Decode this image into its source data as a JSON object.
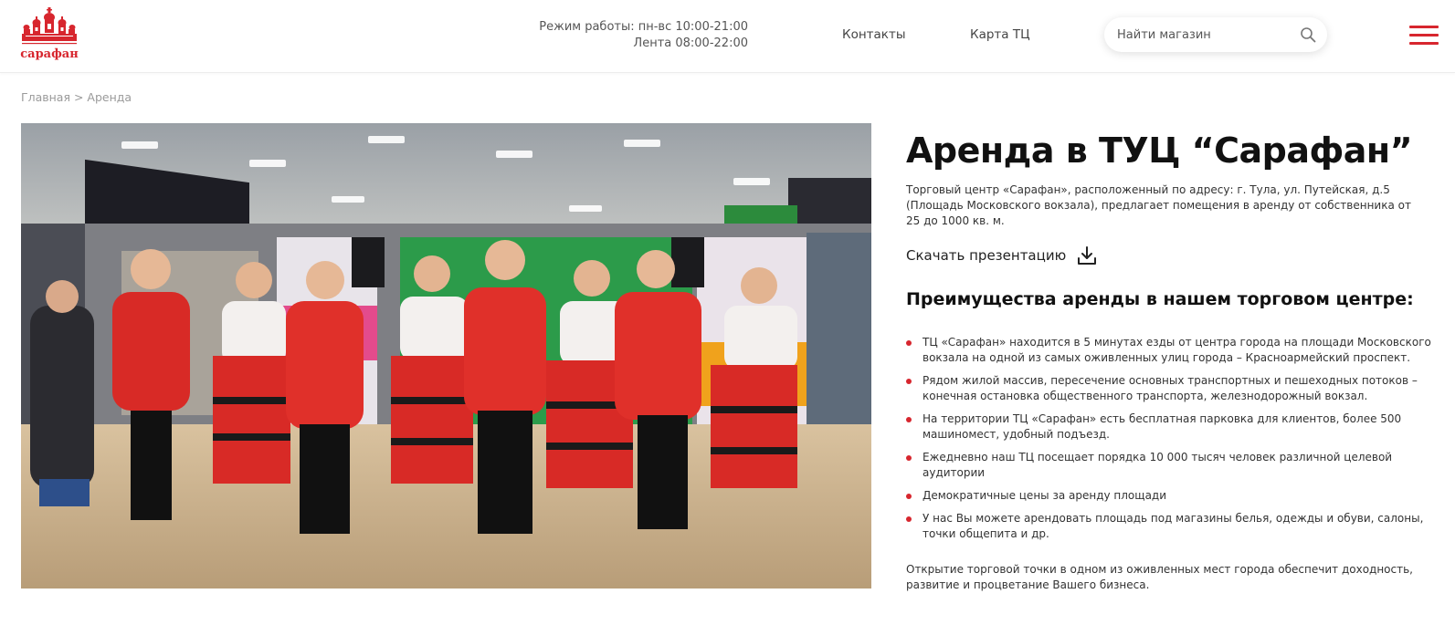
{
  "brand": {
    "logo_text": "сарафан",
    "accent": "#d7262e"
  },
  "header": {
    "hours_line1": "Режим работы: пн-вс 10:00-21:00",
    "hours_line2": "Лента 08:00-22:00",
    "nav": {
      "contacts": "Контакты",
      "map": "Карта ТЦ"
    },
    "search": {
      "placeholder": "Найти магазин",
      "value": ""
    }
  },
  "breadcrumb": {
    "home": "Главная",
    "separator": " > ",
    "current": "Аренда"
  },
  "main": {
    "title": "Аренда в ТУЦ “Сарафан”",
    "intro": "Торговый центр «Сарафан», расположенный по адресу: г. Тула, ул. Путейская, д.5 (Площадь Московского вокзала), предлагает помещения в аренду от собственника от 25 до 1000 кв. м.",
    "download_label": "Скачать презентацию",
    "subtitle": "Преимущества аренды в нашем торговом центре:",
    "benefits": [
      "ТЦ «Сарафан» находится в 5 минутах езды от центра города на площади Московского вокзала на одной из самых оживленных улиц города – Красноармейский проспект.",
      "Рядом жилой массив, пересечение основных транспортных и пешеходных потоков – конечная остановка общественного транспорта, железнодорожный вокзал.",
      "На территории ТЦ «Сарафан» есть бесплатная парковка для клиентов, более 500 машиномест, удобный подъезд.",
      "Ежедневно наш ТЦ посещает порядка 10 000 тысяч человек различной целевой аудитории",
      "Демократичные цены за аренду площади",
      "У нас Вы можете арендовать площадь под магазины белья, одежды и обуви, салоны, точки общепита и др."
    ],
    "outro": "Открытие торговой точки в одном из оживленных мест города обеспечит доходность, развитие и процветание Вашего бизнеса."
  }
}
